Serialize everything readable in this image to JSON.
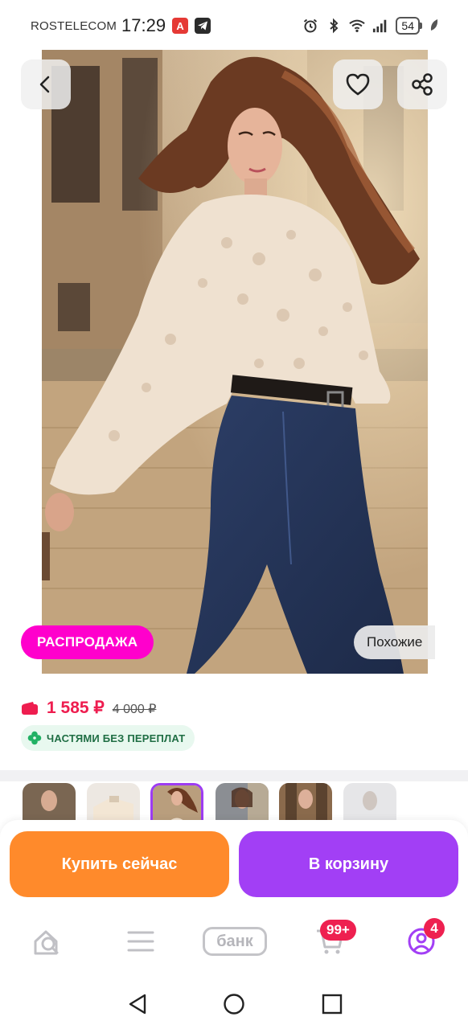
{
  "status_bar": {
    "carrier": "ROSTELECOM",
    "time": "17:29",
    "app_badge_1": "A",
    "battery": "54"
  },
  "product": {
    "sale_badge": "РАСПРОДАЖА",
    "similar_label": "Похожие",
    "price_current": "1 585 ₽",
    "price_old": "4 000 ₽",
    "installment_label": "ЧАСТЯМИ БЕЗ ПЕРЕПЛАТ"
  },
  "thumbnails": {
    "count_shown": 6,
    "selected_index": 2
  },
  "actions": {
    "buy_now_label": "Купить сейчас",
    "add_to_cart_label": "В корзину"
  },
  "bottom_nav": {
    "bank_label": "банк",
    "cart_badge": "99+",
    "profile_badge": "4"
  },
  "colors": {
    "sale_badge": "#ff00cc",
    "price": "#ee1d4f",
    "buy_now": "#ff8a2b",
    "add_to_cart": "#a23ff5",
    "selected_thumb": "#9d3cf2",
    "badge": "#ee2050",
    "installment_bg": "#e8f8ef"
  },
  "icons": [
    "back-icon",
    "heart-icon",
    "share-icon",
    "wallet-icon",
    "clover-icon",
    "home-search-icon",
    "menu-icon",
    "cart-icon",
    "profile-icon",
    "system-back-icon",
    "system-home-icon",
    "system-recents-icon"
  ]
}
